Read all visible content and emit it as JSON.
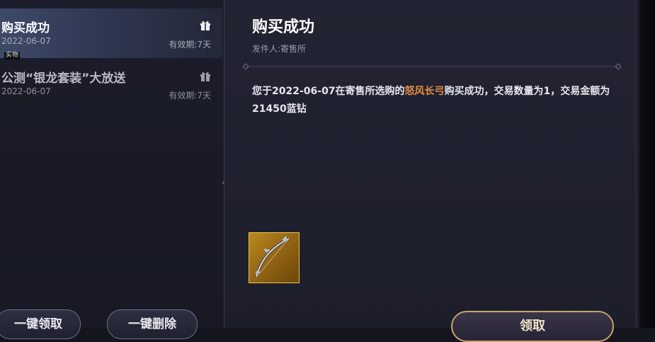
{
  "mail_list": {
    "items": [
      {
        "title": "购买成功",
        "date": "2022-06-07",
        "expiry": "有效期:7天",
        "icon": "gift-icon"
      },
      {
        "title": "公测“银龙套装”大放送",
        "date": "2022-06-07",
        "expiry": "有效期:7天",
        "icon": "gift-icon"
      }
    ],
    "tooltip": "实物"
  },
  "actions": {
    "claim_all": "一键领取",
    "delete_all": "一键删除",
    "claim": "领取"
  },
  "message": {
    "title": "购买成功",
    "sender": "发件人:寄售所",
    "body_before": "您于2022-06-07在寄售所选购的",
    "item_name": "怒风长弓",
    "body_after": "购买成功，交易数量为1，交易金额为21450蓝钻",
    "attachment_icon": "bow-icon"
  },
  "colors": {
    "highlight": "#e48c3f",
    "attachment_bg": "#b98a1f",
    "button_border": "#c8a36a"
  }
}
